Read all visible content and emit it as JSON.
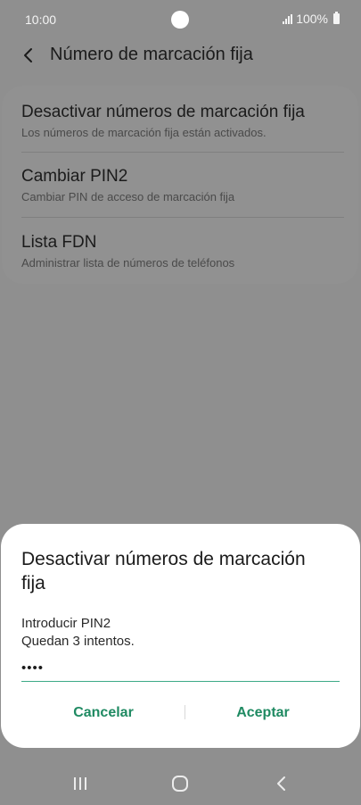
{
  "status_bar": {
    "time": "10:00",
    "battery_text": "100%"
  },
  "top_bar": {
    "title": "Número de marcación fija"
  },
  "settings": {
    "items": [
      {
        "title": "Desactivar números de marcación fija",
        "subtitle": "Los números de marcación fija están activados."
      },
      {
        "title": "Cambiar PIN2",
        "subtitle": "Cambiar PIN de acceso de marcación fija"
      },
      {
        "title": "Lista FDN",
        "subtitle": "Administrar lista de números de teléfonos"
      }
    ]
  },
  "dialog": {
    "title": "Desactivar números de marcación fija",
    "message_line1": "Introducir PIN2",
    "message_line2": "Quedan 3 intentos.",
    "pin_value": "1234",
    "cancel_label": "Cancelar",
    "accept_label": "Aceptar"
  },
  "colors": {
    "accent": "#1f8a62",
    "input_underline": "#3daa86",
    "overlay": "#8f8f8f"
  },
  "icons": {
    "back": "chevron-left-icon",
    "nav_recents": "recents-icon",
    "nav_home": "home-icon",
    "nav_back": "back-icon"
  }
}
